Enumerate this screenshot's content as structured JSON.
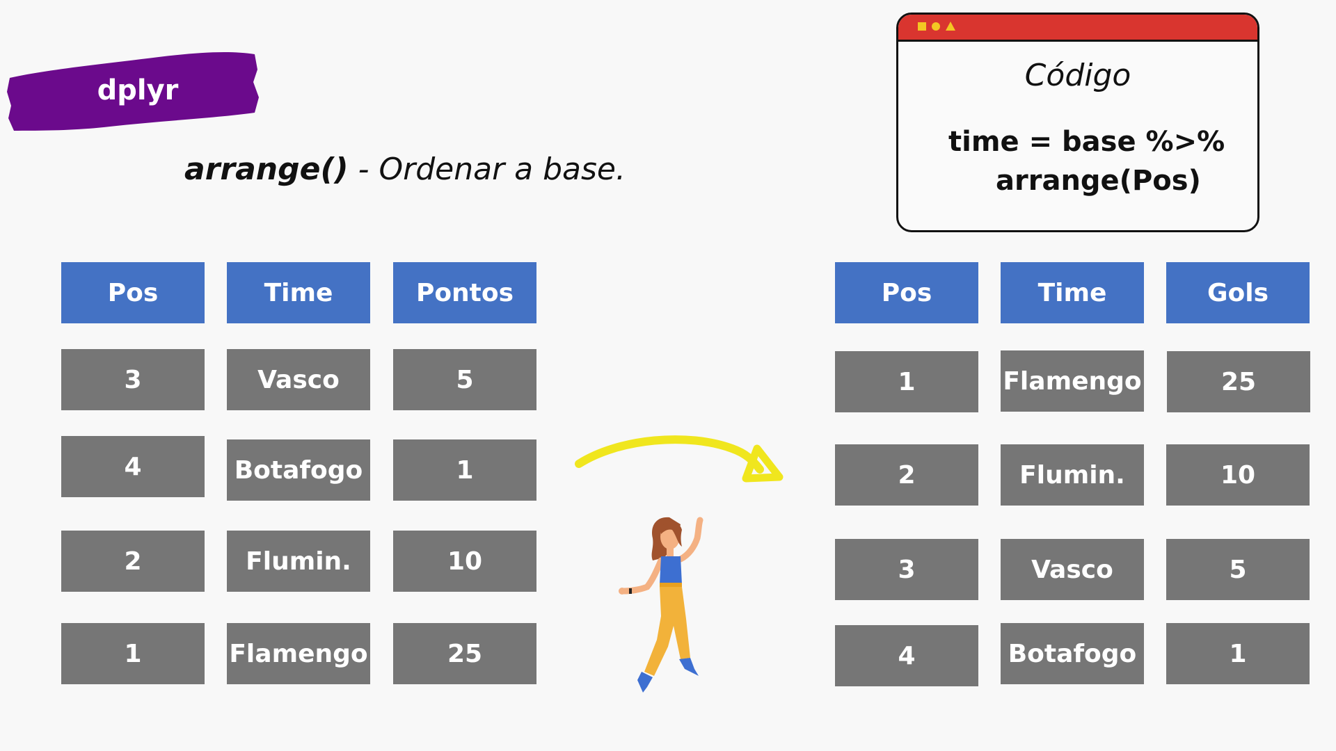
{
  "badge": {
    "label": "dplyr",
    "color": "#6b0a8c"
  },
  "subtitle": {
    "function": "arrange()",
    "description": " - Ordenar a base."
  },
  "code_window": {
    "title": "Código",
    "line1": "time = base %>%",
    "line2": "arrange(Pos)",
    "titlebar_color": "#d9352f"
  },
  "table_before": {
    "headers": [
      "Pos",
      "Time",
      "Pontos"
    ],
    "rows": [
      [
        "3",
        "Vasco",
        "5"
      ],
      [
        "4",
        "Botafogo",
        "1"
      ],
      [
        "2",
        "Flumin.",
        "10"
      ],
      [
        "1",
        "Flamengo",
        "25"
      ]
    ]
  },
  "table_after": {
    "headers": [
      "Pos",
      "Time",
      "Gols"
    ],
    "rows": [
      [
        "1",
        "Flamengo",
        "25"
      ],
      [
        "2",
        "Flumin.",
        "10"
      ],
      [
        "3",
        "Vasco",
        "5"
      ],
      [
        "4",
        "Botafogo",
        "1"
      ]
    ]
  },
  "colors": {
    "header": "#4472c4",
    "cell": "#767676",
    "arrow": "#f0e61e"
  }
}
